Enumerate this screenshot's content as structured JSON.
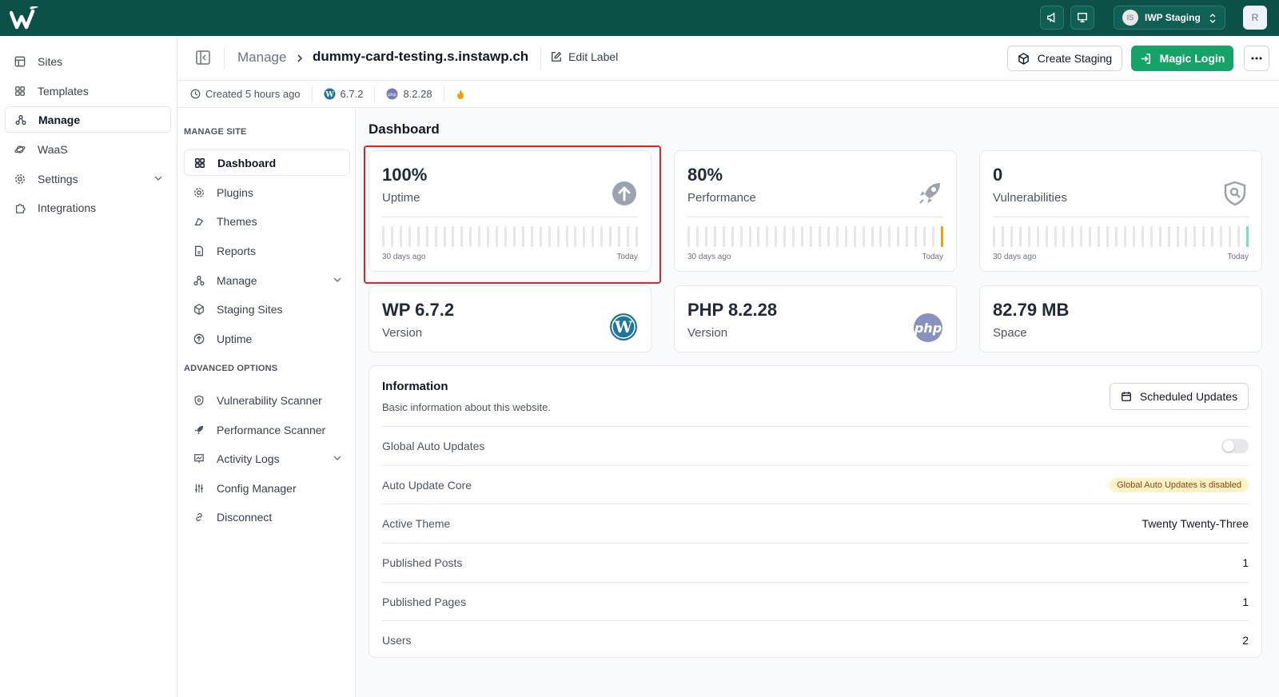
{
  "topbar": {
    "team_initials": "IS",
    "team_name": "IWP Staging",
    "user_initial": "R"
  },
  "sidebar": {
    "items": [
      {
        "label": "Sites",
        "icon": "layout-icon"
      },
      {
        "label": "Templates",
        "icon": "grid-icon"
      },
      {
        "label": "Manage",
        "icon": "network-icon"
      },
      {
        "label": "WaaS",
        "icon": "planet-icon"
      },
      {
        "label": "Settings",
        "icon": "gear-icon"
      },
      {
        "label": "Integrations",
        "icon": "puzzle-icon"
      }
    ]
  },
  "header": {
    "breadcrumb_parent": "Manage",
    "site_name": "dummy-card-testing.s.instawp.ch",
    "edit_label": "Edit Label",
    "create_staging": "Create Staging",
    "magic_login": "Magic Login"
  },
  "meta": {
    "created": "Created 5 hours ago",
    "wp_version": "6.7.2",
    "php_version": "8.2.28"
  },
  "subnav": {
    "section1": "MANAGE SITE",
    "section2": "ADVANCED OPTIONS",
    "items1": [
      "Dashboard",
      "Plugins",
      "Themes",
      "Reports",
      "Manage",
      "Staging Sites",
      "Uptime"
    ],
    "items2": [
      "Vulnerability Scanner",
      "Performance Scanner",
      "Activity Logs",
      "Config Manager",
      "Disconnect"
    ]
  },
  "main": {
    "title": "Dashboard",
    "stats": [
      {
        "value": "100%",
        "label": "Uptime",
        "icon": "arrow-up-circle-icon",
        "from": "30 days ago",
        "to": "Today",
        "last_bar_color": "#e5e7eb"
      },
      {
        "value": "80%",
        "label": "Performance",
        "icon": "rocket-icon",
        "from": "30 days ago",
        "to": "Today",
        "last_bar_color": "#f59e0b"
      },
      {
        "value": "0",
        "label": "Vulnerabilities",
        "icon": "shield-search-icon",
        "from": "30 days ago",
        "to": "Today",
        "last_bar_color": "#6ee7b7"
      }
    ],
    "versions": [
      {
        "value": "WP 6.7.2",
        "label": "Version"
      },
      {
        "value": "PHP 8.2.28",
        "label": "Version",
        "logo_text": "php"
      },
      {
        "value": "82.79 MB",
        "label": "Space"
      }
    ],
    "info": {
      "title": "Information",
      "subtitle": "Basic information about this website.",
      "scheduled_updates": "Scheduled Updates",
      "rows": [
        {
          "key": "Global Auto Updates",
          "value": ""
        },
        {
          "key": "Auto Update Core",
          "value": "Global Auto Updates is disabled"
        },
        {
          "key": "Active Theme",
          "value": "Twenty Twenty-Three"
        },
        {
          "key": "Published Posts",
          "value": "1"
        },
        {
          "key": "Published Pages",
          "value": "1"
        },
        {
          "key": "Users",
          "value": "2"
        }
      ]
    }
  }
}
